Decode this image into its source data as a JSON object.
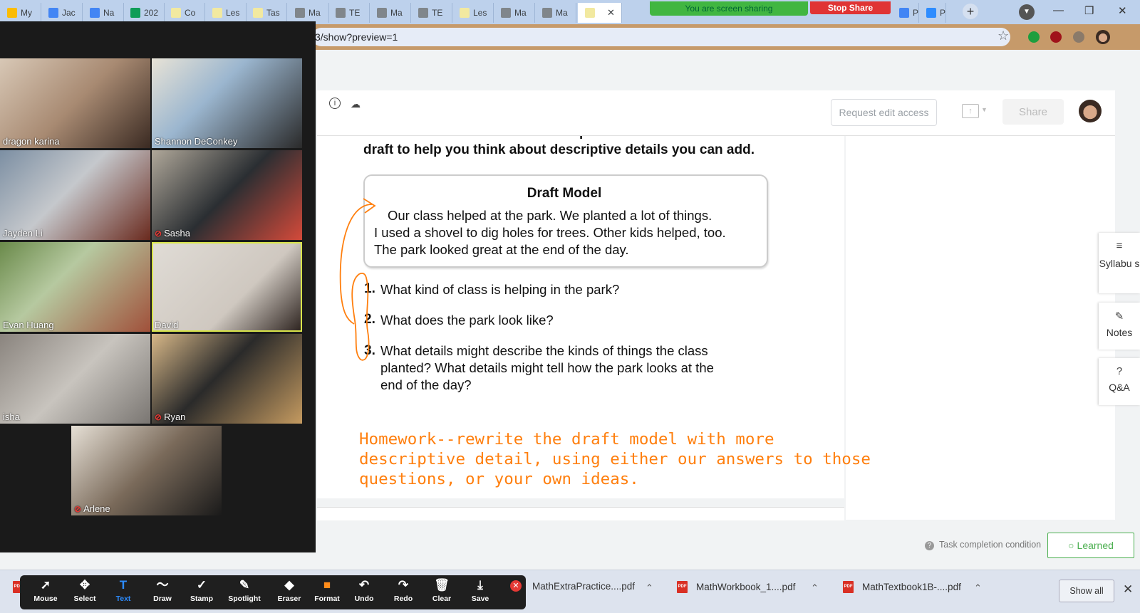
{
  "browser": {
    "tabs": [
      {
        "label": "My",
        "color": "#fbbc04"
      },
      {
        "label": "Jac",
        "color": "#4285f4"
      },
      {
        "label": "Na",
        "color": "#4285f4"
      },
      {
        "label": "202",
        "color": "#0f9d58"
      },
      {
        "label": "Co",
        "color": "#f2e9a0"
      },
      {
        "label": "Les",
        "color": "#f2e9a0"
      },
      {
        "label": "Tas",
        "color": "#f2e9a0"
      },
      {
        "label": "Ma",
        "color": "#80868b"
      },
      {
        "label": "TE",
        "color": "#80868b"
      },
      {
        "label": "Ma",
        "color": "#80868b"
      },
      {
        "label": "TE",
        "color": "#80868b"
      },
      {
        "label": "Les",
        "color": "#f2e9a0"
      },
      {
        "label": "Ma",
        "color": "#80868b"
      },
      {
        "label": "Ma",
        "color": "#80868b"
      },
      {
        "label": "",
        "color": "#f2e9a0"
      }
    ],
    "tabs_right": [
      {
        "label": "Pos",
        "color": "#4285f4"
      },
      {
        "label": "Pos",
        "color": "#2d8cff"
      }
    ],
    "close_tab_glyph": "✕",
    "new_tab_glyph": "+",
    "share_banner": "You are screen sharing",
    "stop_share": "Stop Share",
    "url": "3/show?preview=1",
    "window_controls": [
      "—",
      "❐",
      "✕"
    ]
  },
  "document": {
    "request_edit_label": "Request edit access",
    "share_label": "Share",
    "instruction_line1": "A. Read the draft Model. Use the questions that follow the",
    "instruction_line2": "draft to help you think about descriptive details you can add.",
    "draft_title": "Draft Model",
    "draft_lines": [
      "Our class helped at the park. We planted a lot of things.",
      "I used a shovel to dig holes for trees. Other kids helped, too.",
      "The park looked great at the end of the day."
    ],
    "questions": [
      {
        "num": "1.",
        "lines": [
          "What kind of class is helping in the park?"
        ]
      },
      {
        "num": "2.",
        "lines": [
          "What does the park look like?"
        ]
      },
      {
        "num": "3.",
        "lines": [
          "What details might describe the kinds of things the class",
          "planted? What details might tell how the park looks at the",
          "end of the day?"
        ]
      }
    ],
    "homework_lines": [
      "Homework--rewrite the draft model with more",
      "descriptive detail, using either our answers to those",
      "questions, or your own ideas."
    ],
    "annotation_color": "#ff7f0e"
  },
  "rail": {
    "syllabus": "Syllabu s",
    "notes": "Notes",
    "qa": "Q&A"
  },
  "footer": {
    "task_condition": "Task completion condition",
    "learned": "Learned"
  },
  "zoom": {
    "participants": [
      {
        "name": "dragon karina",
        "muted": false
      },
      {
        "name": "Shannon DeConkey",
        "muted": false
      },
      {
        "name": "Jayden Li",
        "muted": false
      },
      {
        "name": "Sasha",
        "muted": true
      },
      {
        "name": "Evan Huang",
        "muted": false
      },
      {
        "name": "David",
        "muted": false
      },
      {
        "name": "isha",
        "muted": false
      },
      {
        "name": "Ryan",
        "muted": true
      },
      {
        "name": "Arlene",
        "muted": true
      }
    ],
    "tools": [
      {
        "label": "Mouse",
        "icon": "cursor-icon",
        "glyph": "➚"
      },
      {
        "label": "Select",
        "icon": "move-icon",
        "glyph": "✥"
      },
      {
        "label": "Text",
        "icon": "text-icon",
        "glyph": "T"
      },
      {
        "label": "Draw",
        "icon": "draw-icon",
        "glyph": "〜"
      },
      {
        "label": "Stamp",
        "icon": "stamp-icon",
        "glyph": "✓"
      },
      {
        "label": "Spotlight",
        "icon": "spotlight-icon",
        "glyph": "✎"
      },
      {
        "label": "Eraser",
        "icon": "eraser-icon",
        "glyph": "◆"
      },
      {
        "label": "Format",
        "icon": "format-icon",
        "glyph": "■"
      },
      {
        "label": "Undo",
        "icon": "undo-icon",
        "glyph": "↶"
      },
      {
        "label": "Redo",
        "icon": "redo-icon",
        "glyph": "↷"
      },
      {
        "label": "Clear",
        "icon": "trash-icon",
        "glyph": "🗑"
      },
      {
        "label": "Save",
        "icon": "save-icon",
        "glyph": "⤓"
      }
    ],
    "text_tool_color": "#2d8cff",
    "format_color": "#ff8c1a"
  },
  "downloads": {
    "items": [
      "MathExtraPractice....pdf",
      "MathWorkbook_1....pdf",
      "MathTextbook1B-....pdf"
    ],
    "pdf_badge": "PDF",
    "show_all": "Show all",
    "close_glyph": "✕",
    "caret_glyph": "⌃"
  }
}
